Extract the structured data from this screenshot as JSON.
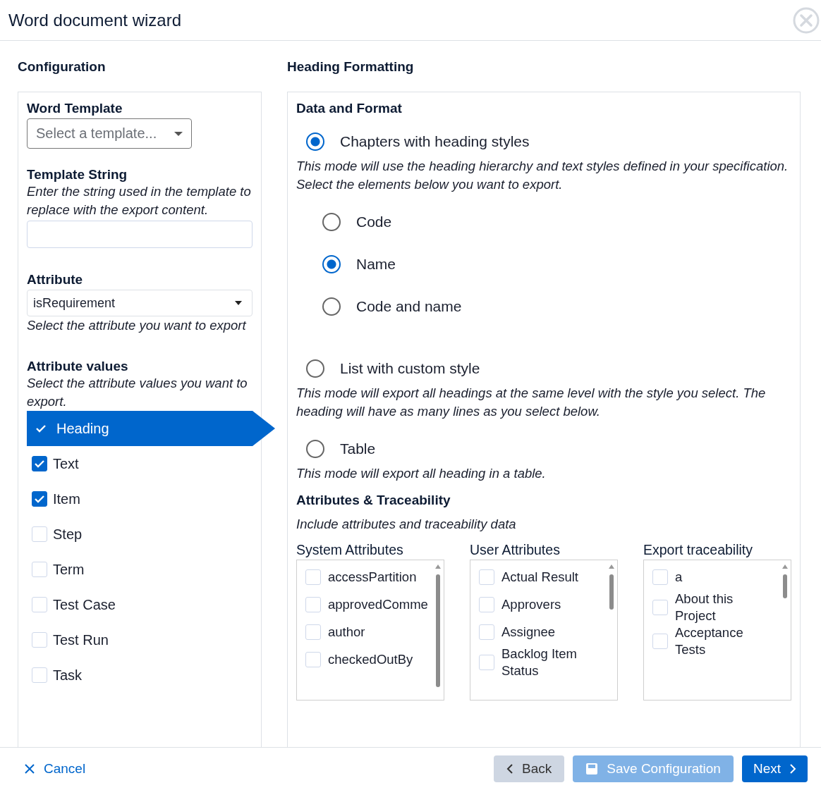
{
  "dialog": {
    "title": "Word document wizard"
  },
  "configuration": {
    "title": "Configuration",
    "word_template": {
      "label": "Word Template",
      "placeholder": "Select a template..."
    },
    "template_string": {
      "label": "Template String",
      "help": "Enter the string used in the template to replace with the export content."
    },
    "attribute": {
      "label": "Attribute",
      "value": "isRequirement",
      "help": "Select the attribute you want to export"
    },
    "attribute_values": {
      "label": "Attribute values",
      "help": "Select the attribute values you want to export.",
      "items": [
        {
          "label": "Heading",
          "checked": true,
          "selected": true
        },
        {
          "label": "Text",
          "checked": true,
          "selected": false
        },
        {
          "label": "Item",
          "checked": true,
          "selected": false
        },
        {
          "label": "Step",
          "checked": false,
          "selected": false
        },
        {
          "label": "Term",
          "checked": false,
          "selected": false
        },
        {
          "label": "Test Case",
          "checked": false,
          "selected": false
        },
        {
          "label": "Test Run",
          "checked": false,
          "selected": false
        },
        {
          "label": "Task",
          "checked": false,
          "selected": false
        }
      ]
    }
  },
  "heading_formatting": {
    "title": "Heading Formatting",
    "section": "Data and Format",
    "modes": [
      {
        "label": "Chapters with heading styles",
        "selected": true,
        "description": "This mode will use the heading hierarchy and text styles defined in your specification. Select the elements below you want to export.",
        "options": [
          {
            "label": "Code",
            "selected": false
          },
          {
            "label": "Name",
            "selected": true
          },
          {
            "label": "Code and name",
            "selected": false
          }
        ]
      },
      {
        "label": "List with custom style",
        "selected": false,
        "description": "This mode will export all headings at the same level with the style you select. The heading will have as many lines as you select below."
      },
      {
        "label": "Table",
        "selected": false,
        "description": "This mode will export all heading in a table."
      }
    ],
    "attributes": {
      "title": "Attributes & Traceability",
      "help": "Include attributes and traceability data",
      "lists": [
        {
          "title": "System Attributes",
          "items": [
            {
              "label": "accessPartition",
              "checked": false
            },
            {
              "label": "approvedComme",
              "checked": false
            },
            {
              "label": "author",
              "checked": false
            },
            {
              "label": "checkedOutBy",
              "checked": false
            }
          ]
        },
        {
          "title": "User Attributes",
          "items": [
            {
              "label": "Actual Result",
              "checked": false
            },
            {
              "label": "Approvers",
              "checked": false
            },
            {
              "label": "Assignee",
              "checked": false
            },
            {
              "label": "Backlog Item Status",
              "checked": false
            }
          ]
        },
        {
          "title": "Export traceability",
          "items": [
            {
              "label": "a",
              "checked": false
            },
            {
              "label": "About this Project",
              "checked": false
            },
            {
              "label": "Acceptance Tests",
              "checked": false
            }
          ]
        }
      ]
    }
  },
  "footer": {
    "cancel": "Cancel",
    "back": {
      "label": "Back",
      "disabled": false
    },
    "save": {
      "label": "Save Configuration",
      "disabled": true
    },
    "next": {
      "label": "Next",
      "disabled": false
    }
  }
}
